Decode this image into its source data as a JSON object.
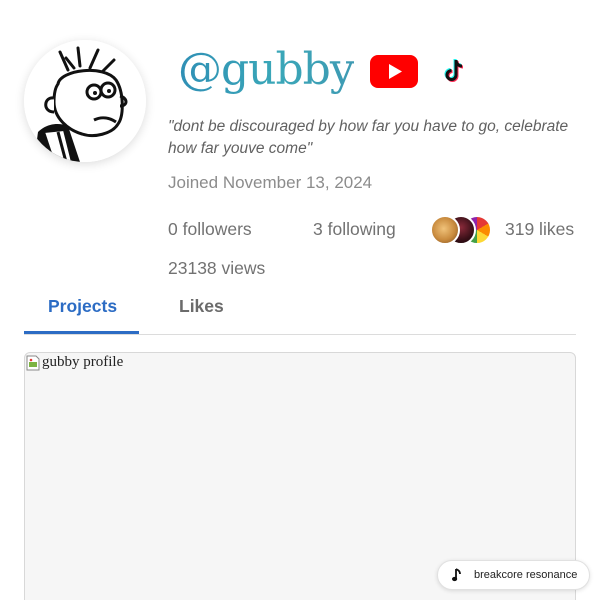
{
  "profile": {
    "username": "@gubby",
    "bio": "\"dont be discouraged by how far you have to go, celebrate how far youve come\"",
    "joined": "Joined November 13, 2024",
    "avatar_icon": "cartoon-kid-avatar",
    "social": {
      "youtube_icon": "youtube-icon",
      "tiktok_icon": "tiktok-icon"
    }
  },
  "stats": {
    "followers": "0 followers",
    "following": "3 following",
    "likes": "319 likes",
    "views": "23138 views"
  },
  "tabs": [
    {
      "label": "Projects",
      "active": true
    },
    {
      "label": "Likes",
      "active": false
    }
  ],
  "content": {
    "image_alt": "gubby profile",
    "music_label": "breakcore resonance",
    "music_icon": "music-note-icon"
  },
  "colors": {
    "accent": "#2c6cc4",
    "username_gradient_start": "#2f8fb5",
    "username_gradient_end": "#3e9ab3"
  }
}
